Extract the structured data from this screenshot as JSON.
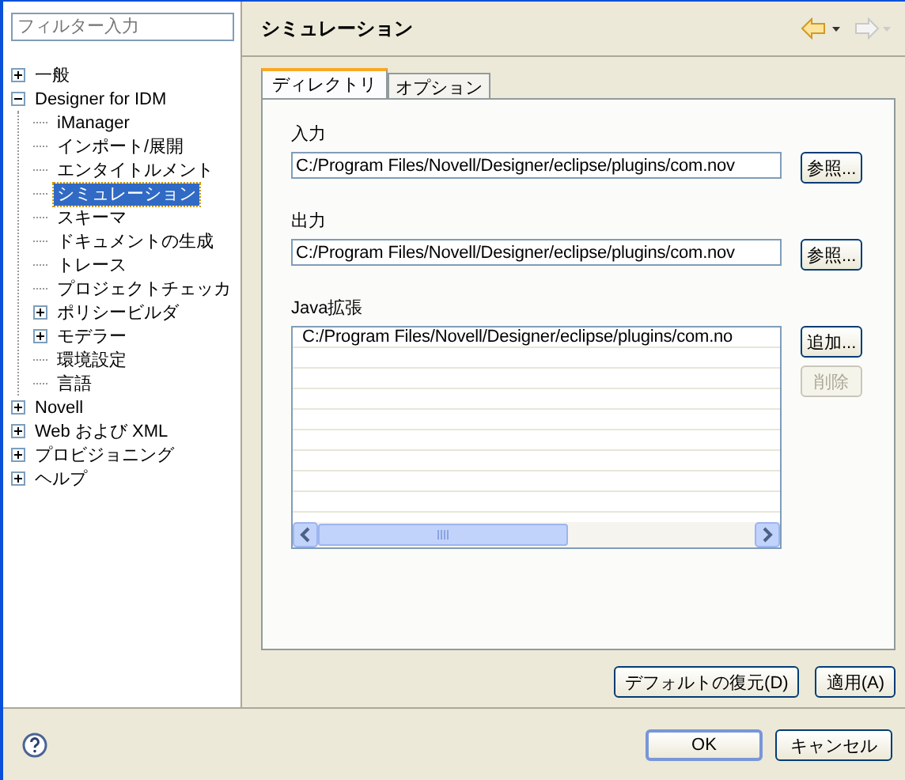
{
  "filter": {
    "placeholder": "フィルター入力"
  },
  "tree": [
    {
      "label": "一般",
      "expanded": false,
      "selected": false
    },
    {
      "label": "Designer for IDM",
      "expanded": true,
      "selected": false,
      "children": [
        {
          "label": "iManager",
          "selected": false
        },
        {
          "label": "インポート/展開",
          "selected": false
        },
        {
          "label": "エンタイトルメント",
          "selected": false
        },
        {
          "label": "シミュレーション",
          "selected": true
        },
        {
          "label": "スキーマ",
          "selected": false
        },
        {
          "label": "ドキュメントの生成",
          "selected": false
        },
        {
          "label": "トレース",
          "selected": false
        },
        {
          "label": "プロジェクトチェッカ",
          "selected": false
        },
        {
          "label": "ポリシービルダ",
          "expanded": false,
          "selected": false
        },
        {
          "label": "モデラー",
          "expanded": false,
          "selected": false
        },
        {
          "label": "環境設定",
          "selected": false
        },
        {
          "label": "言語",
          "selected": false
        }
      ]
    },
    {
      "label": "Novell",
      "expanded": false,
      "selected": false
    },
    {
      "label": "Web および XML",
      "expanded": false,
      "selected": false
    },
    {
      "label": "プロビジョニング",
      "expanded": false,
      "selected": false
    },
    {
      "label": "ヘルプ",
      "expanded": false,
      "selected": false
    }
  ],
  "page_title": "シミュレーション",
  "tabs": [
    {
      "label": "ディレクトリ",
      "selected": true
    },
    {
      "label": "オプション",
      "selected": false
    }
  ],
  "input": {
    "label": "入力",
    "value": "C:/Program Files/Novell/Designer/eclipse/plugins/com.nov",
    "button": "参照..."
  },
  "output": {
    "label": "出力",
    "value": "C:/Program Files/Novell/Designer/eclipse/plugins/com.nov",
    "button": "参照..."
  },
  "java_ext": {
    "label": "Java拡張",
    "rows": [
      "C:/Program Files/Novell/Designer/eclipse/plugins/com.no"
    ],
    "buttons": [
      {
        "label": "追加...",
        "disabled": false
      },
      {
        "label": "削除",
        "disabled": true
      }
    ]
  },
  "page_buttons": [
    "デフォルトの復元(D)",
    "適用(A)"
  ],
  "dialog_buttons": [
    "OK",
    "キャンセル"
  ]
}
